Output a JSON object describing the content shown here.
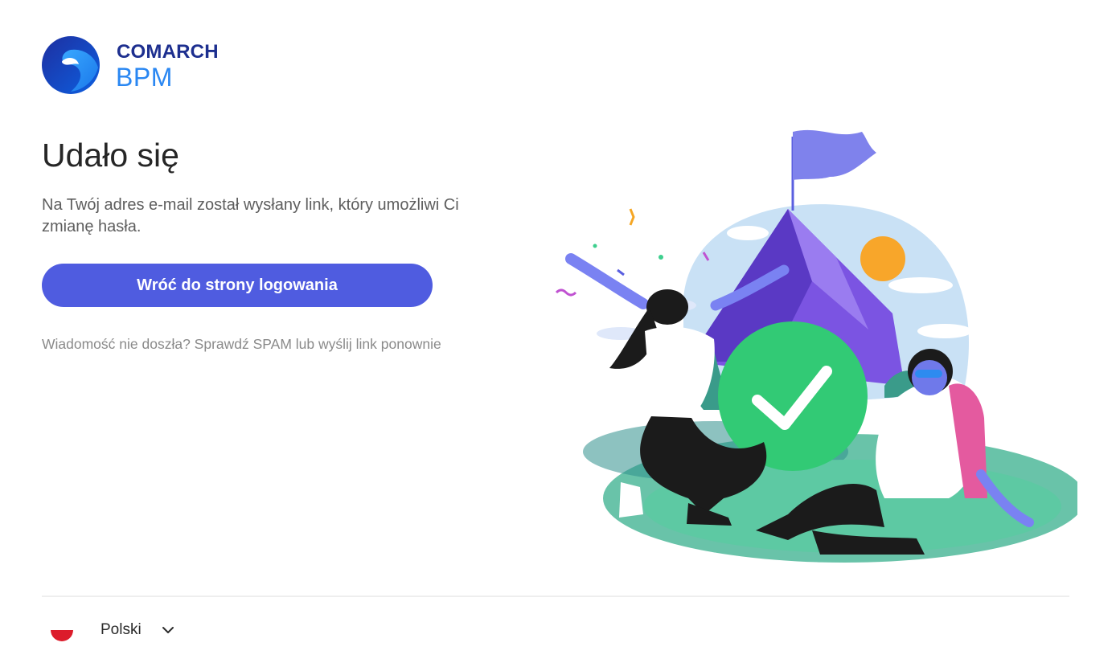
{
  "brand": {
    "line1": "COMARCH",
    "line2": "BPM",
    "colors": {
      "dark_blue": "#1d2f8f",
      "light_blue": "#2a87f2"
    },
    "icon": "comarch-logo-icon"
  },
  "main": {
    "title": "Udało się",
    "message": "Na Twój adres e-mail został wysłany link, który umożliwi Ci zmianę hasła.",
    "back_button_label": "Wróć do strony logowania",
    "resend_text": "Wiadomość nie doszła? Sprawdź SPAM lub wyślij link ponownie"
  },
  "illustration": {
    "icon": "success-mountain-illustration"
  },
  "footer": {
    "language": "Polski",
    "flag_icon": "poland-flag-icon",
    "chevron_icon": "chevron-down-icon"
  },
  "colors": {
    "accent": "#4f5ce0",
    "success": "#33d17a"
  }
}
